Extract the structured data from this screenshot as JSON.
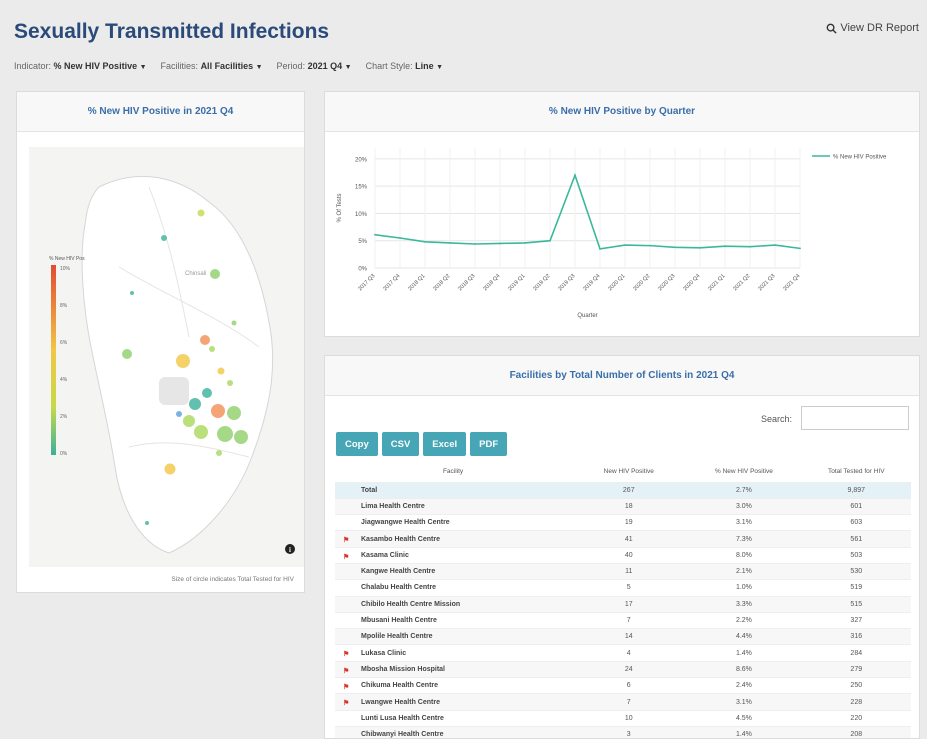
{
  "header": {
    "title": "Sexually Transmitted Infections",
    "report_link": "View DR Report"
  },
  "filters": [
    {
      "label": "Indicator:",
      "value": "% New HIV Positive"
    },
    {
      "label": "Facilities:",
      "value": "All Facilities"
    },
    {
      "label": "Period:",
      "value": "2021 Q4"
    },
    {
      "label": "Chart Style:",
      "value": "Line"
    }
  ],
  "map": {
    "title": "% New HIV Positive in 2021 Q4",
    "legend_title": "% New HIV Pos",
    "legend_ticks": [
      "10%",
      "8%",
      "6%",
      "4%",
      "2%",
      "0%"
    ],
    "town_label": "Chinsali",
    "footnote": "Size of circle indicates Total Tested for HIV",
    "info_icon": "info-icon"
  },
  "chart": {
    "title": "% New HIV Positive by Quarter"
  },
  "chart_data": {
    "type": "line",
    "xlabel": "Quarter",
    "ylabel": "% Of Tests",
    "ylim": [
      0,
      22
    ],
    "yticks": [
      "20%",
      "15%",
      "10%",
      "5%",
      "0%"
    ],
    "legend_position": "top-right",
    "x": [
      "2017 Q3",
      "2017 Q4",
      "2018 Q1",
      "2018 Q2",
      "2018 Q3",
      "2018 Q4",
      "2019 Q1",
      "2019 Q2",
      "2019 Q3",
      "2019 Q4",
      "2020 Q1",
      "2020 Q2",
      "2020 Q3",
      "2020 Q4",
      "2021 Q1",
      "2021 Q2",
      "2021 Q3",
      "2021 Q4"
    ],
    "series": [
      {
        "name": "% New HIV Positive",
        "color": "#3bb89c",
        "values": [
          6.1,
          5.5,
          4.8,
          4.6,
          4.4,
          4.5,
          4.6,
          5.0,
          17.0,
          3.5,
          4.2,
          4.1,
          3.8,
          3.7,
          4.0,
          3.9,
          4.2,
          3.6
        ]
      }
    ]
  },
  "table": {
    "title": "Facilities by Total Number of Clients in 2021 Q4",
    "search_label": "Search:",
    "search_value": "",
    "buttons": [
      "Copy",
      "CSV",
      "Excel",
      "PDF"
    ],
    "columns": [
      "Facility",
      "New HIV Positive",
      "% New HIV Positive",
      "Total Tested for HIV"
    ],
    "rows": [
      {
        "facility": "Total",
        "new_pos": "267",
        "pct": "2.7%",
        "tested": "9,897",
        "flag": false,
        "total": true
      },
      {
        "facility": "Lima Health Centre",
        "new_pos": "18",
        "pct": "3.0%",
        "tested": "601",
        "flag": false
      },
      {
        "facility": "Jiagwangwe Health Centre",
        "new_pos": "19",
        "pct": "3.1%",
        "tested": "603",
        "flag": false
      },
      {
        "facility": "Kasambo Health Centre",
        "new_pos": "41",
        "pct": "7.3%",
        "tested": "561",
        "flag": true
      },
      {
        "facility": "Kasama Clinic",
        "new_pos": "40",
        "pct": "8.0%",
        "tested": "503",
        "flag": true
      },
      {
        "facility": "Kangwe Health Centre",
        "new_pos": "11",
        "pct": "2.1%",
        "tested": "530",
        "flag": false
      },
      {
        "facility": "Chalabu Health Centre",
        "new_pos": "5",
        "pct": "1.0%",
        "tested": "519",
        "flag": false
      },
      {
        "facility": "Chibilo Health Centre Mission",
        "new_pos": "17",
        "pct": "3.3%",
        "tested": "515",
        "flag": false
      },
      {
        "facility": "Mbusani Health Centre",
        "new_pos": "7",
        "pct": "2.2%",
        "tested": "327",
        "flag": false
      },
      {
        "facility": "Mpolile Health Centre",
        "new_pos": "14",
        "pct": "4.4%",
        "tested": "316",
        "flag": false
      },
      {
        "facility": "Lukasa Clinic",
        "new_pos": "4",
        "pct": "1.4%",
        "tested": "284",
        "flag": true
      },
      {
        "facility": "Mbosha Mission Hospital",
        "new_pos": "24",
        "pct": "8.6%",
        "tested": "279",
        "flag": true
      },
      {
        "facility": "Chikuma Health Centre",
        "new_pos": "6",
        "pct": "2.4%",
        "tested": "250",
        "flag": true
      },
      {
        "facility": "Lwangwe Health Centre",
        "new_pos": "7",
        "pct": "3.1%",
        "tested": "228",
        "flag": true
      },
      {
        "facility": "Lunti Lusa Health Centre",
        "new_pos": "10",
        "pct": "4.5%",
        "tested": "220",
        "flag": false
      },
      {
        "facility": "Chibwanyi Health Centre",
        "new_pos": "3",
        "pct": "1.4%",
        "tested": "208",
        "flag": false
      }
    ]
  },
  "colors": {
    "title": "#2a4a7a",
    "panel_title": "#3a6ea8",
    "button": "#46a6b5",
    "line": "#3bb89c",
    "flag": "#d9332b"
  }
}
